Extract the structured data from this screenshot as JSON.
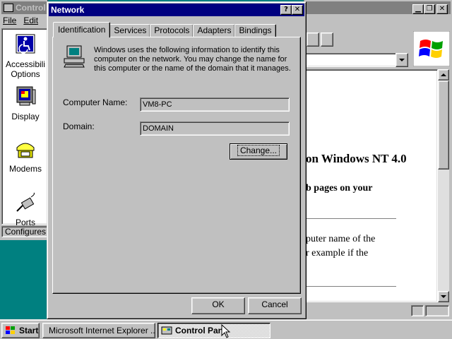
{
  "control_panel": {
    "title": "Control",
    "menu": [
      "File",
      "Edit"
    ],
    "items": [
      {
        "label_line1": "Accessibili",
        "label_line2": "Options",
        "icon": "accessibility-icon"
      },
      {
        "label_line1": "Display",
        "icon": "display-icon"
      },
      {
        "label_line1": "Modems",
        "icon": "modem-icon"
      },
      {
        "label_line1": "Ports",
        "icon": "ports-icon"
      }
    ],
    "status": "Configures n"
  },
  "ie": {
    "doc_heading": "on Windows NT 4.0",
    "doc_subheading": "b pages on your",
    "doc_line1": "puter name of the",
    "doc_line2": "r example if the"
  },
  "dialog": {
    "title": "Network",
    "help_btn": "?",
    "close_btn": "✕",
    "tabs": [
      "Identification",
      "Services",
      "Protocols",
      "Adapters",
      "Bindings"
    ],
    "selected_tab": "Identification",
    "intro": "Windows uses the following information to identify this computer on the network.  You may change the name for this computer or the name of the domain that it manages.",
    "computer_name_label": "Computer Name:",
    "computer_name_value": "VM8-PC",
    "domain_label": "Domain:",
    "domain_value": "DOMAIN",
    "change_btn": "Change...",
    "ok_btn": "OK",
    "cancel_btn": "Cancel"
  },
  "taskbar": {
    "start": "Start",
    "tasks": [
      "Microsoft Internet Explorer ...",
      "Control Pan"
    ]
  }
}
